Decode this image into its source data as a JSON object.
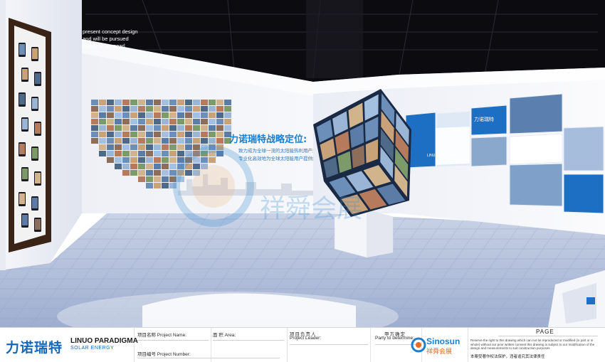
{
  "scene": {
    "wall_overlay_text": [
      "present concept design",
      "and will be pursued",
      "cation of the pearl"
    ],
    "wall_title": "力诺瑞特战略定位:",
    "wall_body": [
      "致力成为全球一流的太阳能热利用产业领军",
      "专业化高效地为全球太阳能用户提供解决方案"
    ],
    "watermark_cn": "祥舜会展",
    "cube_brand": "LINUO PARADIGMA",
    "panel_logo": "力诺瑞特",
    "colors": {
      "brand_blue": "#1767b8",
      "sinosun_orange": "#e36b24",
      "floor": "#a9b7d3"
    }
  },
  "title_block": {
    "company_cn": "力诺瑞特",
    "company_en": "LINUO PARADIGMA",
    "company_sub": "SOLAR ENERGY",
    "project_name": "项目名称 Project Name:",
    "area": "面 积 Area:",
    "project_leader_cn": "项目负责人",
    "project_leader_en": "Project Leader:",
    "party_a_cn": "甲方确定",
    "party_a_en": "Party to determine:",
    "project_number": "项目编号 Project Number:",
    "sinosun_en": "Sinosun",
    "sinosun_cn": "祥舜会展",
    "page_label": "PAGE",
    "copyright_note": "Reserve the right to this drawing which can not be reproduced or modified (in part or in whole) without our prior written consent this drawing is subject to our modification of the design and measurements to suit construction purposes",
    "copyright_cn": "本案受著作权法保护，违者追究其法律责任"
  }
}
